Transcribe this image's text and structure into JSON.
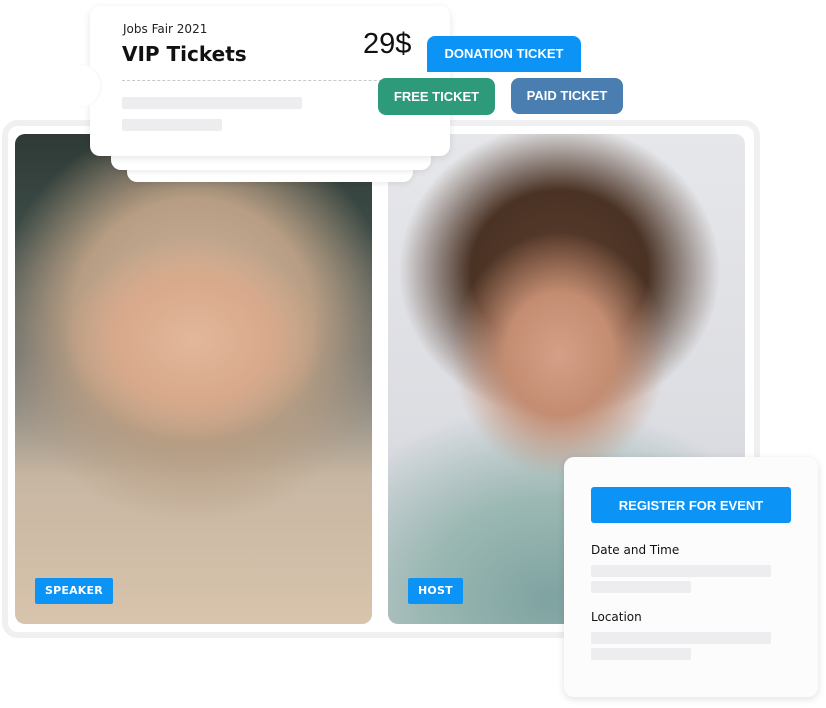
{
  "ticket": {
    "event_name": "Jobs Fair 2021",
    "title": "VIP Tickets",
    "price": "29$"
  },
  "ticket_types": {
    "donation": "DONATION TICKET",
    "free": "FREE TICKET",
    "paid": "PAID TICKET"
  },
  "people": [
    {
      "role": "SPEAKER"
    },
    {
      "role": "HOST"
    }
  ],
  "register": {
    "button_label": "REGISTER FOR EVENT",
    "date_label": "Date and Time",
    "location_label": "Location"
  },
  "colors": {
    "primary_blue": "#0b93f6",
    "free_green": "#2d9a79",
    "paid_blue": "#4a7eb0",
    "skeleton": "#ededef"
  }
}
